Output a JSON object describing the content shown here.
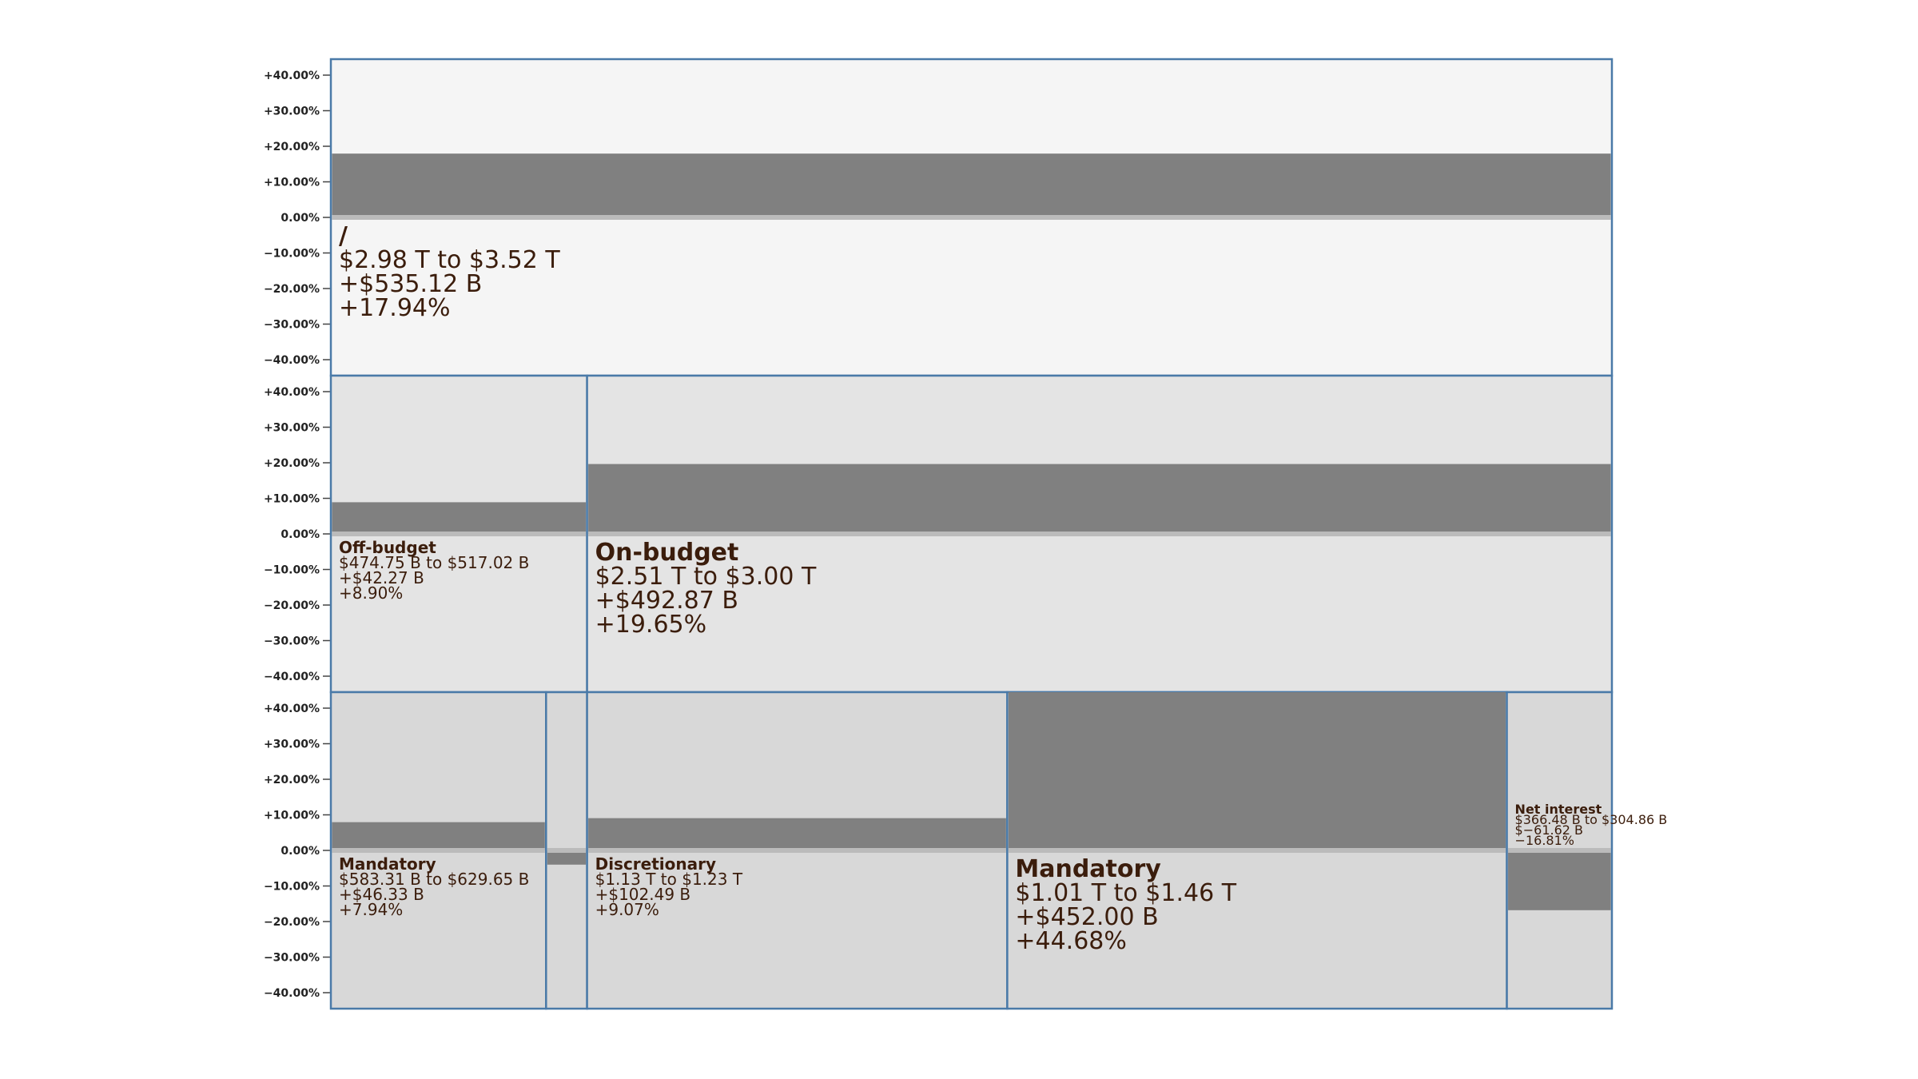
{
  "chart_data": {
    "type": "treemap-bar",
    "title": "",
    "ylim": [
      -40,
      40
    ],
    "y_ticks": [
      "+40.00%",
      "+30.00%",
      "+20.00%",
      "+10.00%",
      "0.00%",
      "−10.00%",
      "−20.00%",
      "−30.00%",
      "−40.00%"
    ],
    "levels": [
      {
        "name": "level-0",
        "tint": "#f5f5f5",
        "nodes": [
          {
            "name": "/",
            "range": "$2.98 T to $3.52 T",
            "change": "+$535.12 B",
            "pct_text": "+17.94%",
            "pct": 17.94,
            "share": 1.0
          }
        ]
      },
      {
        "name": "level-1",
        "tint": "#e4e4e4",
        "nodes": [
          {
            "name": "Off-budget",
            "range": "$474.75 B to $517.02 B",
            "change": "+$42.27 B",
            "pct_text": "+8.90%",
            "pct": 8.9,
            "share": 0.2
          },
          {
            "name": "On-budget",
            "range": "$2.51 T to $3.00 T",
            "change": "+$492.87 B",
            "pct_text": "+19.65%",
            "pct": 19.65,
            "share": 0.8
          }
        ]
      },
      {
        "name": "level-2",
        "tint": "#d8d8d8",
        "nodes": [
          {
            "name": "Mandatory",
            "range": "$583.31 B to $629.65 B",
            "change": "+$46.33 B",
            "pct_text": "+7.94%",
            "pct": 7.94,
            "share": 0.168
          },
          {
            "name": "",
            "range": "",
            "change": "",
            "pct_text": "",
            "pct": -4.0,
            "share": 0.032
          },
          {
            "name": "Discretionary",
            "range": "$1.13 T to $1.23 T",
            "change": "+$102.49 B",
            "pct_text": "+9.07%",
            "pct": 9.07,
            "share": 0.328
          },
          {
            "name": "Mandatory",
            "range": "$1.01 T to $1.46 T",
            "change": "+$452.00 B",
            "pct_text": "+44.68%",
            "pct": 44.68,
            "share": 0.39
          },
          {
            "name": "Net interest",
            "range": "$366.48 B to $304.86 B",
            "change": "$−61.62 B",
            "pct_text": "−16.81%",
            "pct": -16.81,
            "share": 0.082
          }
        ]
      }
    ],
    "colors": {
      "bar": "#808080",
      "zero_line": "#bbbbbb",
      "border": "#4a7aa8",
      "text": "#3b1d0c"
    }
  }
}
